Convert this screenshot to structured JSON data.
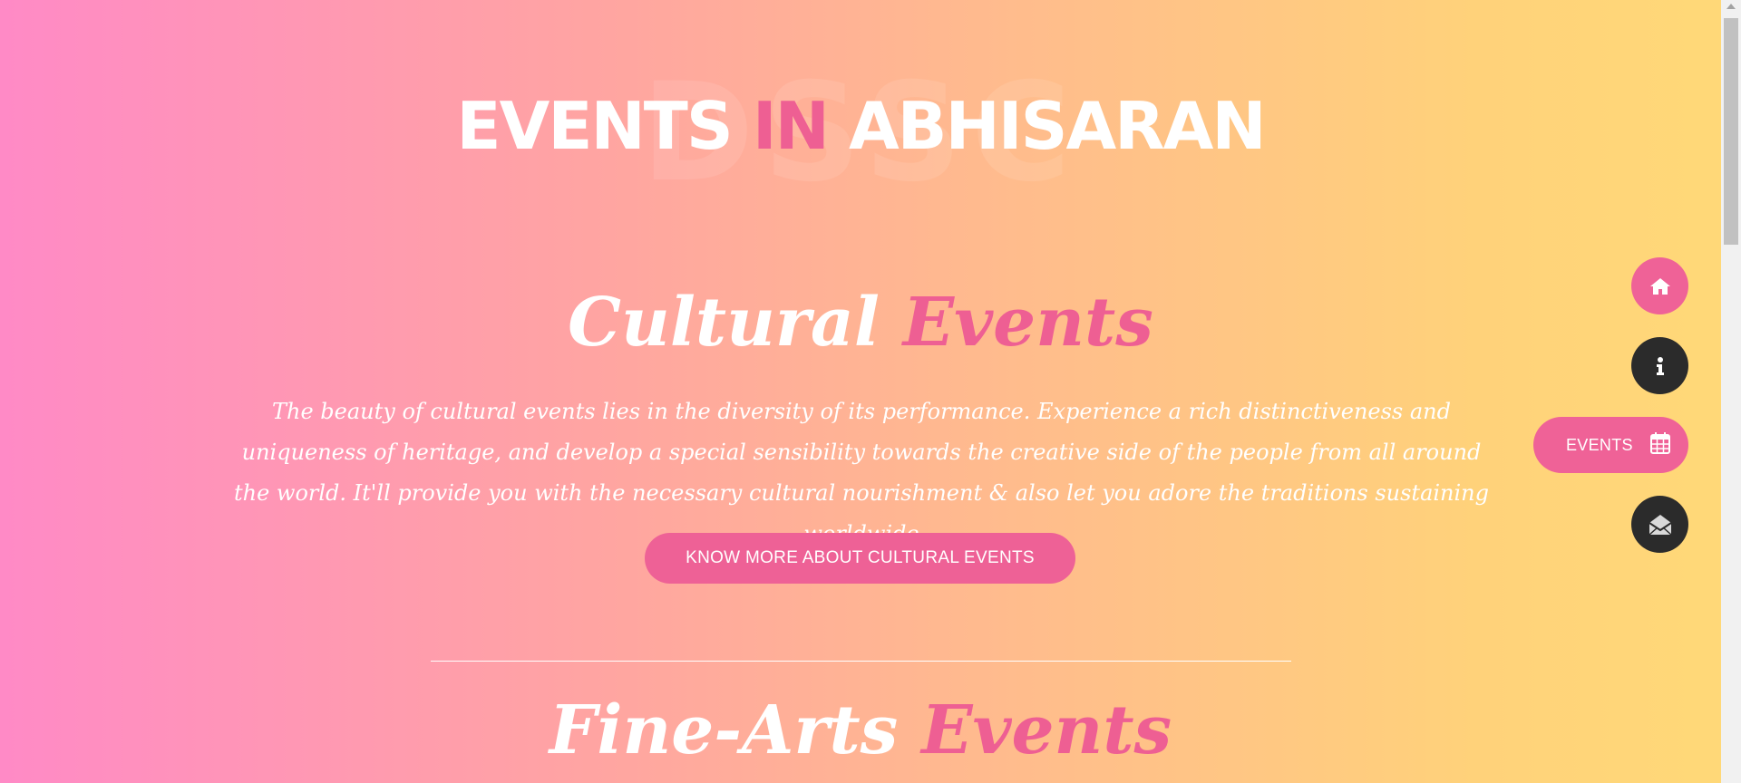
{
  "header": {
    "ghost_text": "DSSC",
    "title_part1": "EVENTS",
    "title_accent": "IN",
    "title_part2": "ABHISARAN"
  },
  "cultural": {
    "title_main": "Cultural",
    "title_accent": "Events",
    "description": "The beauty of cultural events lies in the diversity of its performance. Experience a rich distinctiveness and uniqueness of heritage, and develop a special sensibility towards the creative side of the people from all around the world. It'll provide you with the necessary cultural nourishment & also let you adore the traditions sustaining worldwide",
    "button_label": "KNOW MORE ABOUT CULTURAL EVENTS"
  },
  "finearts": {
    "title_main": "Fine-Arts",
    "title_accent": "Events"
  },
  "side_nav": {
    "home_icon": "home-icon",
    "about_icon": "info-icon",
    "events_label": "EVENTS",
    "events_icon": "calendar-icon",
    "contact_icon": "envelope-open-icon"
  },
  "colors": {
    "accent": "#ee5f93",
    "dark_button": "#2b2b2b",
    "gradient_start": "#ff8ac6",
    "gradient_end": "#ffd978"
  }
}
